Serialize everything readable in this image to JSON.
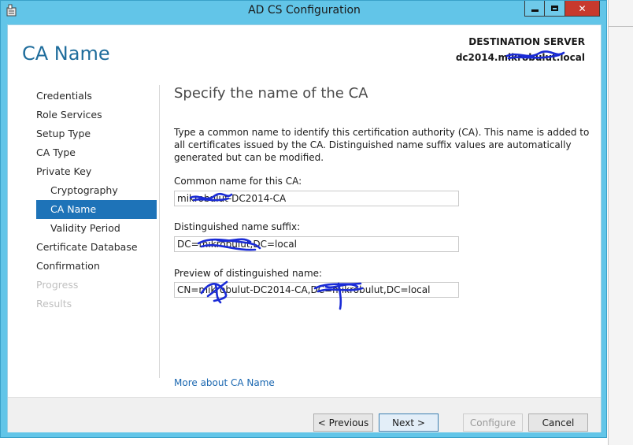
{
  "window": {
    "title": "AD CS Configuration",
    "controls": {
      "minimize": "",
      "maximize": "",
      "close": "✕"
    }
  },
  "header": {
    "page_title": "CA Name",
    "destination_label": "DESTINATION SERVER",
    "destination_server": "dc2014.mikrobulut.local"
  },
  "nav": {
    "items": [
      {
        "label": "Credentials",
        "state": "normal"
      },
      {
        "label": "Role Services",
        "state": "normal"
      },
      {
        "label": "Setup Type",
        "state": "normal"
      },
      {
        "label": "CA Type",
        "state": "normal"
      },
      {
        "label": "Private Key",
        "state": "normal"
      },
      {
        "label": "Cryptography",
        "state": "sub"
      },
      {
        "label": "CA Name",
        "state": "active"
      },
      {
        "label": "Validity Period",
        "state": "sub"
      },
      {
        "label": "Certificate Database",
        "state": "normal"
      },
      {
        "label": "Confirmation",
        "state": "normal"
      },
      {
        "label": "Progress",
        "state": "disabled"
      },
      {
        "label": "Results",
        "state": "disabled"
      }
    ]
  },
  "content": {
    "heading": "Specify the name of the CA",
    "description": "Type a common name to identify this certification authority (CA). This name is added to all certificates issued by the CA. Distinguished name suffix values are automatically generated but can be modified.",
    "common_name_label": "Common name for this CA:",
    "common_name_value": "mikrobulut-DC2014-CA",
    "dn_suffix_label": "Distinguished name suffix:",
    "dn_suffix_value": "DC=mikrobulut,DC=local",
    "preview_label": "Preview of distinguished name:",
    "preview_value": "CN=mikrobulut-DC2014-CA,DC=mikrobulut,DC=local",
    "more_link": "More about CA Name"
  },
  "footer": {
    "previous": "< Previous",
    "next": "Next >",
    "configure": "Configure",
    "cancel": "Cancel"
  },
  "colors": {
    "titlebar": "#62c5e8",
    "accent": "#1f6d9c",
    "nav_active": "#1e73b8",
    "link": "#1a67b0",
    "close_button": "#c7392d",
    "redaction_ink": "#1a2bd6"
  }
}
